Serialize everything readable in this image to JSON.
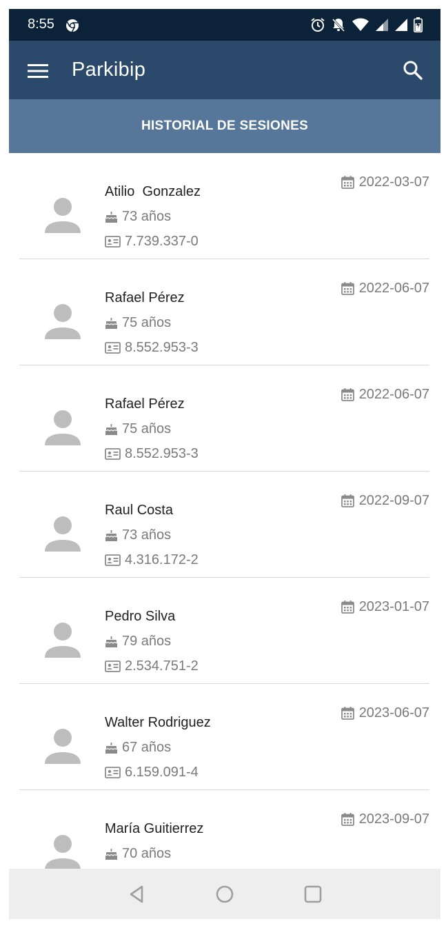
{
  "status_bar": {
    "time": "8:55",
    "icons": [
      "chrome-icon",
      "alarm-icon",
      "notifications-off-icon",
      "wifi-icon",
      "signal-icon",
      "signal-icon",
      "battery-icon"
    ]
  },
  "app_bar": {
    "title": "Parkibip",
    "menu_icon": "menu-icon",
    "search_icon": "search-icon",
    "background": "#2b4a6b"
  },
  "section_header": {
    "title": "HISTORIAL DE SESIONES",
    "background": "#56769a"
  },
  "sessions": [
    {
      "name": "Atilio  Gonzalez",
      "age": "73 años",
      "doc_id": "7.739.337-0",
      "date": "2022-03-07"
    },
    {
      "name": "Rafael Pérez",
      "age": "75 años",
      "doc_id": "8.552.953-3",
      "date": "2022-06-07"
    },
    {
      "name": "Rafael Pérez",
      "age": "75 años",
      "doc_id": "8.552.953-3",
      "date": "2022-06-07"
    },
    {
      "name": "Raul Costa",
      "age": "73 años",
      "doc_id": "4.316.172-2",
      "date": "2022-09-07"
    },
    {
      "name": "Pedro Silva",
      "age": "79 años",
      "doc_id": "2.534.751-2",
      "date": "2023-01-07"
    },
    {
      "name": "Walter Rodriguez",
      "age": "67 años",
      "doc_id": "6.159.091-4",
      "date": "2023-06-07"
    },
    {
      "name": "María Guitierrez",
      "age": "70 años",
      "doc_id": "",
      "date": "2023-09-07"
    }
  ],
  "nav_bar": {
    "buttons": [
      "back-icon",
      "home-icon",
      "recents-icon"
    ]
  }
}
